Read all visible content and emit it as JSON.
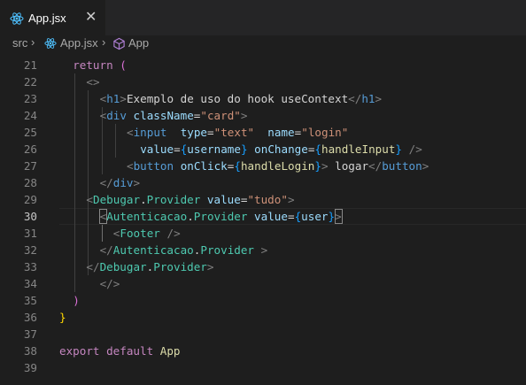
{
  "tab": {
    "label": "App.jsx",
    "close": "✕",
    "icon": "react-icon"
  },
  "breadcrumb": {
    "folder": "src",
    "file": "App.jsx",
    "symbol": "App",
    "separator": "›"
  },
  "editor": {
    "active_line": "30",
    "lines": [
      {
        "num": "21",
        "tokens": [
          [
            "kw",
            "return"
          ],
          [
            "text",
            " "
          ],
          [
            "brace2",
            "("
          ]
        ]
      },
      {
        "num": "22",
        "tokens": [
          [
            "punc",
            "<>"
          ]
        ]
      },
      {
        "num": "23",
        "tokens": [
          [
            "punc",
            "<"
          ],
          [
            "tag",
            "h1"
          ],
          [
            "punc",
            ">"
          ],
          [
            "text",
            "Exemplo de uso do hook useContext"
          ],
          [
            "punc",
            "</"
          ],
          [
            "tag",
            "h1"
          ],
          [
            "punc",
            ">"
          ]
        ]
      },
      {
        "num": "24",
        "tokens": [
          [
            "punc",
            "<"
          ],
          [
            "tag",
            "div"
          ],
          [
            "text",
            " "
          ],
          [
            "attr",
            "className"
          ],
          [
            "text",
            "="
          ],
          [
            "str",
            "\"card\""
          ],
          [
            "punc",
            ">"
          ]
        ]
      },
      {
        "num": "25",
        "tokens": [
          [
            "punc",
            "<"
          ],
          [
            "tag",
            "input"
          ],
          [
            "text",
            "  "
          ],
          [
            "attr",
            "type"
          ],
          [
            "text",
            "="
          ],
          [
            "str",
            "\"text\""
          ],
          [
            "text",
            "  "
          ],
          [
            "attr",
            "name"
          ],
          [
            "text",
            "="
          ],
          [
            "str",
            "\"login\""
          ]
        ]
      },
      {
        "num": "26",
        "tokens": [
          [
            "attr",
            "value"
          ],
          [
            "text",
            "="
          ],
          [
            "brace3",
            "{"
          ],
          [
            "var",
            "username"
          ],
          [
            "brace3",
            "}"
          ],
          [
            "text",
            " "
          ],
          [
            "attr",
            "onChange"
          ],
          [
            "text",
            "="
          ],
          [
            "brace3",
            "{"
          ],
          [
            "fn",
            "handleInput"
          ],
          [
            "brace3",
            "}"
          ],
          [
            "text",
            " "
          ],
          [
            "punc",
            "/>"
          ]
        ]
      },
      {
        "num": "27",
        "tokens": [
          [
            "punc",
            "<"
          ],
          [
            "tag",
            "button"
          ],
          [
            "text",
            " "
          ],
          [
            "attr",
            "onClick"
          ],
          [
            "text",
            "="
          ],
          [
            "brace3",
            "{"
          ],
          [
            "fn",
            "handleLogin"
          ],
          [
            "brace3",
            "}"
          ],
          [
            "punc",
            ">"
          ],
          [
            "text",
            " logar"
          ],
          [
            "punc",
            "</"
          ],
          [
            "tag",
            "button"
          ],
          [
            "punc",
            ">"
          ]
        ]
      },
      {
        "num": "28",
        "tokens": [
          [
            "punc",
            "</"
          ],
          [
            "tag",
            "div"
          ],
          [
            "punc",
            ">"
          ]
        ]
      },
      {
        "num": "29",
        "tokens": [
          [
            "punc",
            "<"
          ],
          [
            "comp",
            "Debugar"
          ],
          [
            "text",
            "."
          ],
          [
            "comp",
            "Provider"
          ],
          [
            "text",
            " "
          ],
          [
            "attr",
            "value"
          ],
          [
            "text",
            "="
          ],
          [
            "str",
            "\"tudo\""
          ],
          [
            "punc",
            ">"
          ]
        ]
      },
      {
        "num": "30",
        "tokens": [
          [
            "punc",
            "<"
          ],
          [
            "comp",
            "Autenticacao"
          ],
          [
            "text",
            "."
          ],
          [
            "comp",
            "Provider"
          ],
          [
            "text",
            " "
          ],
          [
            "attr",
            "value"
          ],
          [
            "text",
            "="
          ],
          [
            "brace3",
            "{"
          ],
          [
            "var",
            "user"
          ],
          [
            "brace3",
            "}"
          ],
          [
            "punc",
            ">"
          ]
        ]
      },
      {
        "num": "31",
        "tokens": [
          [
            "punc",
            "<"
          ],
          [
            "comp",
            "Footer"
          ],
          [
            "text",
            " "
          ],
          [
            "punc",
            "/>"
          ]
        ]
      },
      {
        "num": "32",
        "tokens": [
          [
            "punc",
            "</"
          ],
          [
            "comp",
            "Autenticacao"
          ],
          [
            "text",
            "."
          ],
          [
            "comp",
            "Provider"
          ],
          [
            "text",
            " "
          ],
          [
            "punc",
            ">"
          ]
        ]
      },
      {
        "num": "33",
        "tokens": [
          [
            "punc",
            "</"
          ],
          [
            "comp",
            "Debugar"
          ],
          [
            "text",
            "."
          ],
          [
            "comp",
            "Provider"
          ],
          [
            "punc",
            ">"
          ]
        ]
      },
      {
        "num": "34",
        "tokens": [
          [
            "punc",
            "</>"
          ]
        ]
      },
      {
        "num": "35",
        "tokens": [
          [
            "brace2",
            ")"
          ]
        ]
      },
      {
        "num": "36",
        "tokens": [
          [
            "brace1",
            "}"
          ]
        ]
      },
      {
        "num": "37",
        "tokens": []
      },
      {
        "num": "38",
        "tokens": [
          [
            "kw",
            "export"
          ],
          [
            "text",
            " "
          ],
          [
            "kw",
            "default"
          ],
          [
            "text",
            " "
          ],
          [
            "fn",
            "App"
          ]
        ]
      },
      {
        "num": "39",
        "tokens": []
      }
    ]
  }
}
